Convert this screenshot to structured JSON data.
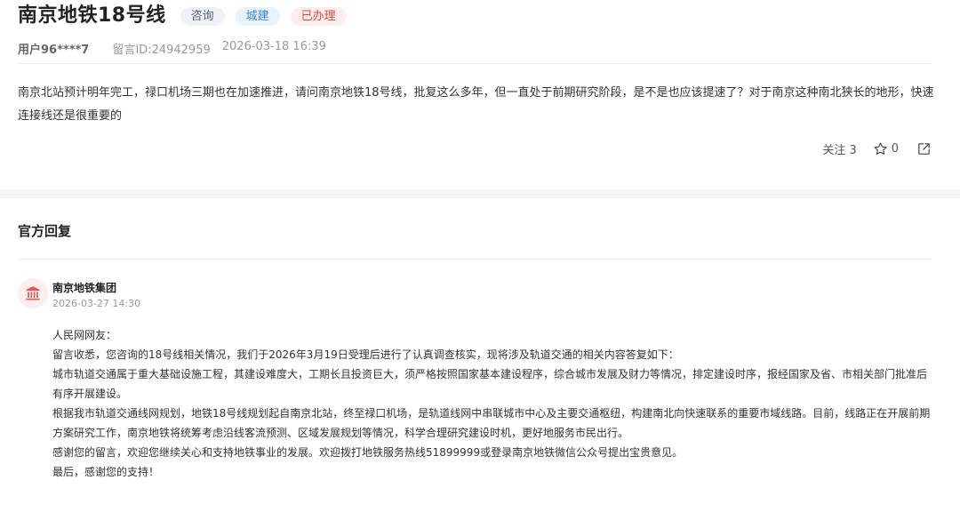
{
  "post": {
    "title": "南京地铁18号线",
    "tags": [
      "咨询",
      "城建",
      "已办理"
    ],
    "user": "用户96****7",
    "message_id": "留言ID:24942959",
    "datetime": "2026-03-18 16:39",
    "content": "南京北站预计明年完工，禄口机场三期也在加速推进，请问南京地铁18号线，批复这么多年，但一直处于前期研究阶段，是不是也应该提速了？对于南京这种南北狭长的地形，快速连接线还是很重要的",
    "follow_label": "关注 3",
    "like_count": "0"
  },
  "reply": {
    "heading": "官方回复",
    "org_name": "南京地铁集团",
    "org_time": "2026-03-27 14:30",
    "paragraphs": [
      "人民网网友：",
      "留言收悉，您咨询的18号线相关情况，我们于2026年3月19日受理后进行了认真调查核实，现将涉及轨道交通的相关内容答复如下：",
      "城市轨道交通属于重大基础设施工程，其建设难度大，工期长且投资巨大，须严格按照国家基本建设程序，综合城市发展及财力等情况，排定建设时序，报经国家及省、市相关部门批准后有序开展建设。",
      "根据我市轨道交通线网规划，地铁18号线规划起自南京北站，终至禄口机场，是轨道线网中串联城市中心及主要交通枢纽，构建南北向快速联系的重要市域线路。目前，线路正在开展前期方案研究工作，南京地铁将统筹考虑沿线客流预测、区域发展规划等情况，科学合理研究建设时机，更好地服务市民出行。",
      "感谢您的留言，欢迎您继续关心和支持地铁事业的发展。欢迎拨打地铁服务热线51899999或登录南京地铁微信公众号提出宝贵意见。",
      "最后，感谢您的支持！"
    ]
  },
  "colors": {
    "tag_red": "#e2443f",
    "tag_blue": "#3a84d6",
    "avatar_icon": "#e05a5a"
  },
  "icons": [
    "star-icon",
    "share-icon",
    "government-building-icon"
  ]
}
